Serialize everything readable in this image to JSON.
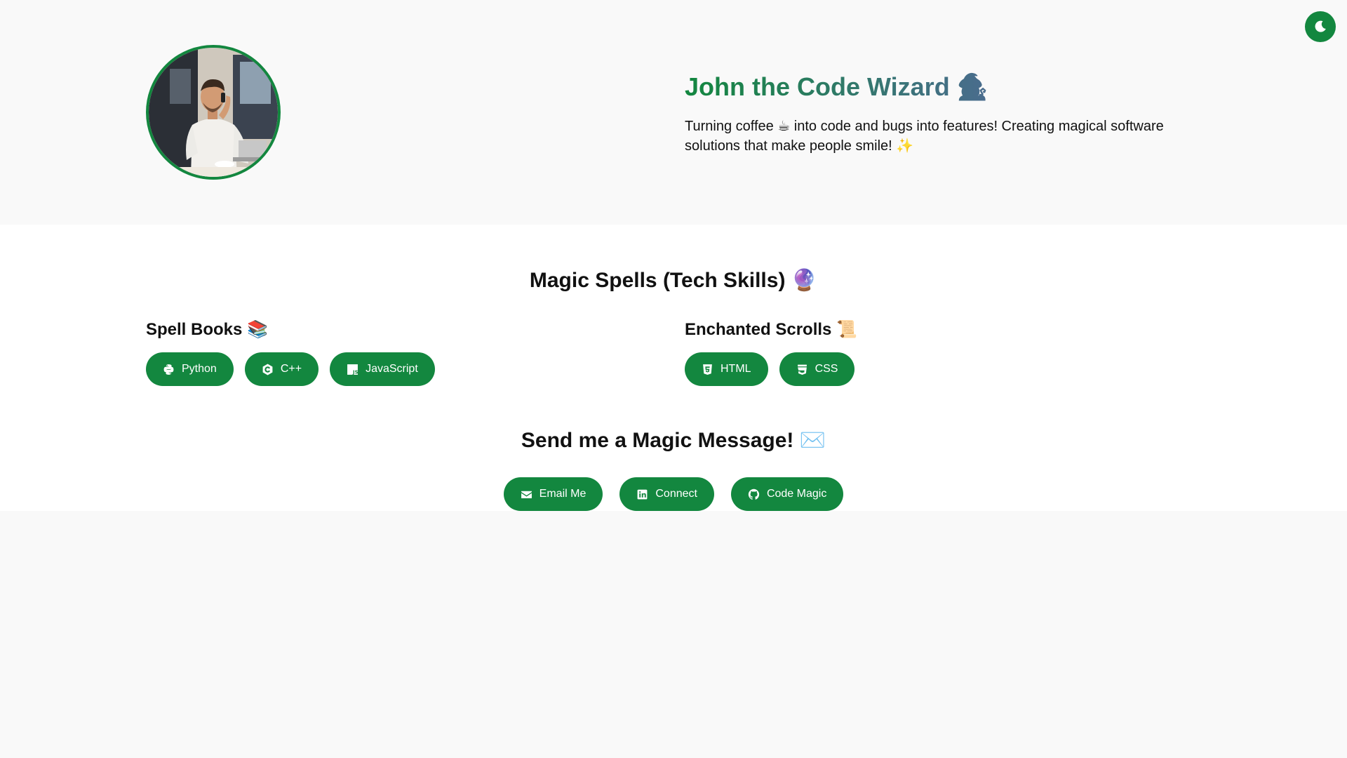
{
  "header": {
    "name": "John the Code Wizard 🧙‍♂️",
    "tagline": "Turning coffee ☕ into code and bugs into features! Creating magical software solutions that make people smile! ✨",
    "avatar_icon": "developer-photo"
  },
  "theme_toggle": {
    "icon": "moon-icon"
  },
  "skills": {
    "title": "Magic Spells (Tech Skills) 🔮",
    "spell_books": {
      "title": "Spell Books 📚",
      "items": [
        {
          "label": "Python",
          "icon": "python-icon"
        },
        {
          "label": "C++",
          "icon": "cplusplus-icon"
        },
        {
          "label": "JavaScript",
          "icon": "javascript-icon"
        }
      ]
    },
    "enchanted_scrolls": {
      "title": "Enchanted Scrolls 📜",
      "items": [
        {
          "label": "HTML",
          "icon": "html5-icon"
        },
        {
          "label": "CSS",
          "icon": "css3-icon"
        }
      ]
    }
  },
  "contact": {
    "title": "Send me a Magic Message! ✉️",
    "buttons": [
      {
        "label": "Email Me",
        "icon": "envelope-icon"
      },
      {
        "label": "Connect",
        "icon": "linkedin-icon"
      },
      {
        "label": "Code Magic",
        "icon": "github-icon"
      }
    ]
  },
  "colors": {
    "accent": "#13873f",
    "name_gradient_end": "#4a6c8e",
    "page_background": "#f9f9f9",
    "section_background": "#ffffff"
  }
}
